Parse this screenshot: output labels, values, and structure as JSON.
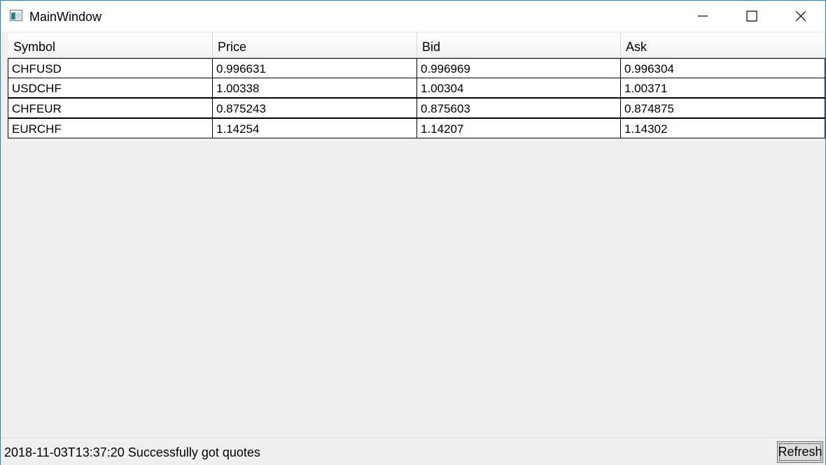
{
  "window": {
    "title": "MainWindow",
    "accent_color": "#1883d7"
  },
  "caption_buttons": [
    "minimize-icon",
    "maximize-icon",
    "close-icon"
  ],
  "grid": {
    "columns": [
      "Symbol",
      "Price",
      "Bid",
      "Ask"
    ],
    "rows": [
      [
        "CHFUSD",
        "0.996631",
        "0.996969",
        "0.996304"
      ],
      [
        "USDCHF",
        "1.00338",
        "1.00304",
        "1.00371"
      ],
      [
        "CHFEUR",
        "0.875243",
        "0.875603",
        "0.874875"
      ],
      [
        "EURCHF",
        "1.14254",
        "1.14207",
        "1.14302"
      ]
    ]
  },
  "status": {
    "message": "2018-11-03T13:37:20 Successfully got quotes"
  },
  "toolbar": {
    "refresh_label": "Refresh"
  }
}
